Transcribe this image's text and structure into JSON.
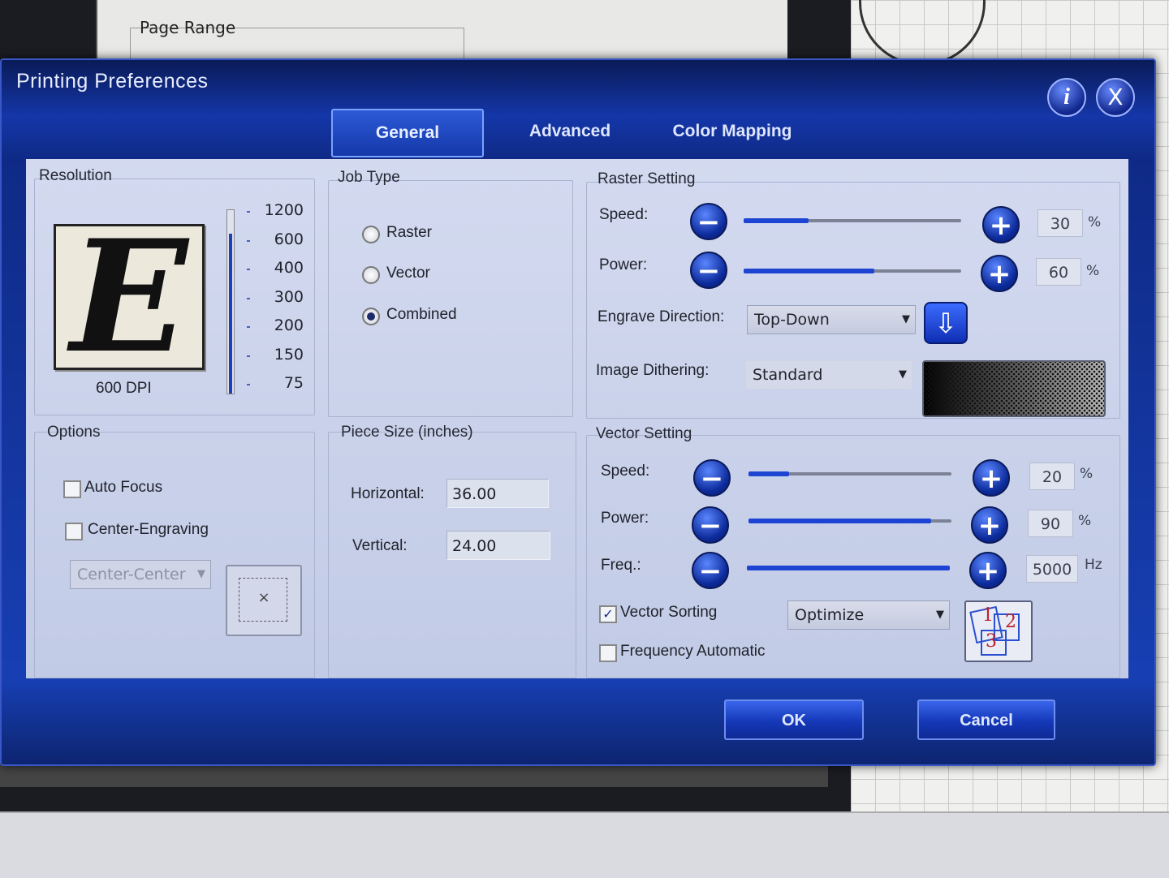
{
  "background": {
    "page_range_label": "Page Range"
  },
  "dialog": {
    "title": "Printing Preferences",
    "info_icon": "info-icon",
    "close_icon": "close-icon",
    "info_glyph": "i",
    "close_glyph": "X"
  },
  "tabs": [
    {
      "label": "General",
      "active": true
    },
    {
      "label": "Advanced",
      "active": false
    },
    {
      "label": "Color Mapping",
      "active": false
    }
  ],
  "resolution": {
    "label": "Resolution",
    "preview_letter": "E",
    "current": "600 DPI",
    "levels": [
      "1200",
      "600",
      "400",
      "300",
      "200",
      "150",
      "75"
    ],
    "selected_index": 1
  },
  "job_type": {
    "label": "Job Type",
    "options": [
      "Raster",
      "Vector",
      "Combined"
    ],
    "selected": "Combined"
  },
  "raster": {
    "label": "Raster Setting",
    "speed_label": "Speed:",
    "speed_value": "30",
    "speed_fraction": 0.3,
    "power_label": "Power:",
    "power_value": "60",
    "power_fraction": 0.6,
    "percent": "%",
    "engrave_direction_label": "Engrave Direction:",
    "engrave_direction_value": "Top-Down",
    "image_dithering_label": "Image Dithering:",
    "image_dithering_value": "Standard"
  },
  "options": {
    "label": "Options",
    "auto_focus_label": "Auto Focus",
    "auto_focus_checked": false,
    "center_engraving_label": "Center-Engraving",
    "center_engraving_checked": false,
    "center_position_value": "Center-Center"
  },
  "piece_size": {
    "label": "Piece Size (inches)",
    "horizontal_label": "Horizontal:",
    "horizontal_value": "36.00",
    "vertical_label": "Vertical:",
    "vertical_value": "24.00"
  },
  "vector": {
    "label": "Vector Setting",
    "speed_label": "Speed:",
    "speed_value": "20",
    "speed_fraction": 0.2,
    "power_label": "Power:",
    "power_value": "90",
    "power_fraction": 0.9,
    "freq_label": "Freq.:",
    "freq_value": "5000",
    "freq_fraction": 1.0,
    "percent": "%",
    "hz": "Hz",
    "vector_sorting_label": "Vector Sorting",
    "vector_sorting_checked": true,
    "vector_sorting_value": "Optimize",
    "frequency_automatic_label": "Frequency Automatic",
    "frequency_automatic_checked": false
  },
  "buttons": {
    "ok": "OK",
    "cancel": "Cancel"
  },
  "colors": {
    "dialog_blue": "#1436a8",
    "panel": "#c9d1e8",
    "slider_fill": "#1d44d2"
  }
}
